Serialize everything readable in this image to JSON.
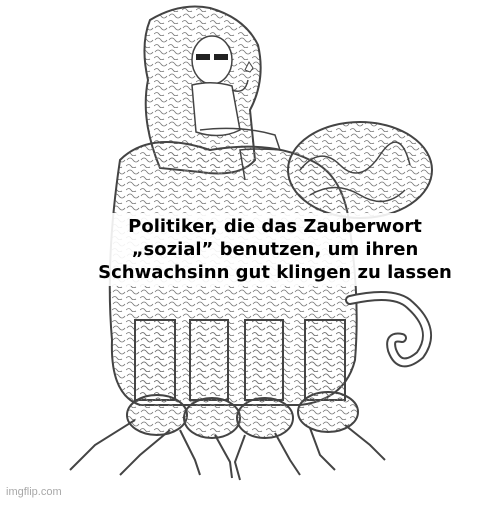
{
  "meme": {
    "caption_lines": [
      "Politiker, die das Zauberwort",
      "„sozial” benutzen, um ihren",
      "Schwachsinn gut klingen zu lassen"
    ],
    "watermark": "imgflip.com"
  },
  "colors": {
    "background": "#ffffff",
    "line_art": "#444444",
    "text": "#000000",
    "watermark": "#a8a8a8"
  },
  "icons": [
    "wojak-figure",
    "brain-creature",
    "brain-legs",
    "sunglasses"
  ]
}
